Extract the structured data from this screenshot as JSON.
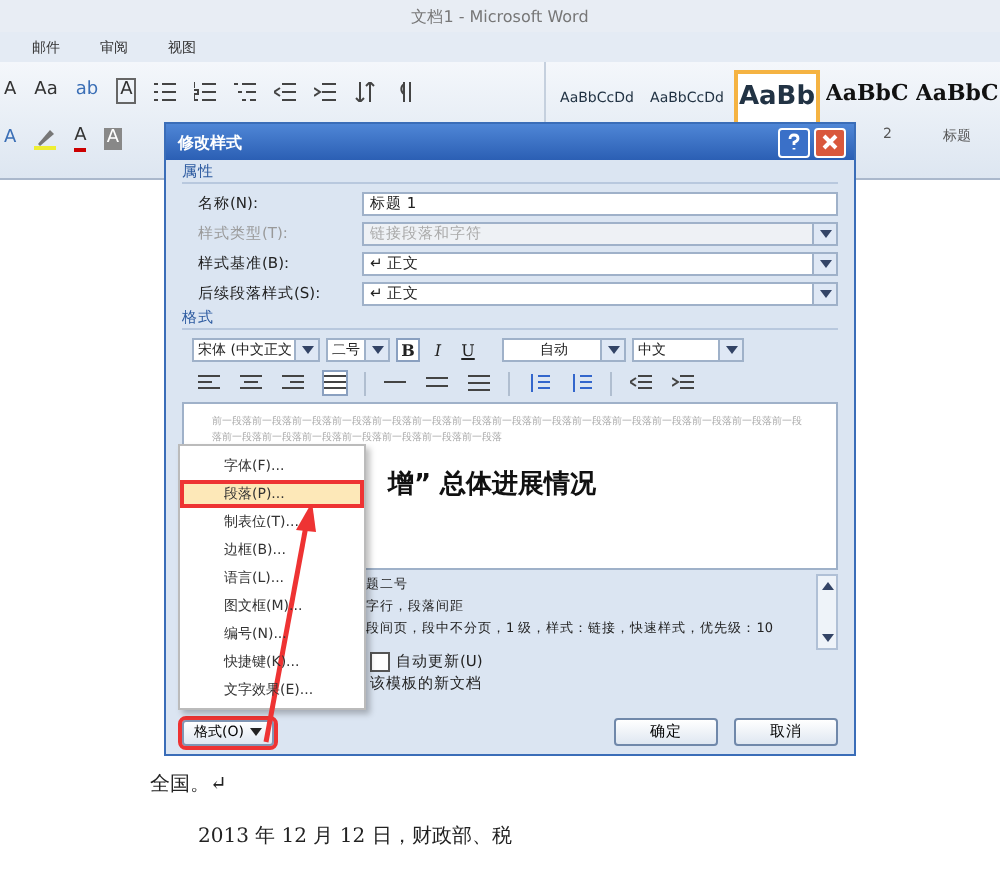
{
  "window": {
    "title": "文档1 - Microsoft Word"
  },
  "ribbon_tabs": [
    "邮件",
    "审阅",
    "视图"
  ],
  "ribbon_row1": [
    {
      "kind": "font_size",
      "text": "A"
    },
    {
      "kind": "change_case",
      "text": "Aa"
    },
    {
      "kind": "phonetic",
      "text": "ab"
    },
    {
      "kind": "border",
      "text": "A"
    },
    {
      "kind": "bullets"
    },
    {
      "kind": "numbering"
    },
    {
      "kind": "multilevel"
    },
    {
      "kind": "outdent"
    },
    {
      "kind": "indent"
    },
    {
      "kind": "sort"
    },
    {
      "kind": "marks"
    }
  ],
  "ribbon_row2": [
    {
      "kind": "effect",
      "text": "A"
    },
    {
      "kind": "highlight"
    },
    {
      "kind": "font_color",
      "text": "A"
    },
    {
      "kind": "shading",
      "text": "A"
    }
  ],
  "style_gallery": [
    {
      "preview": "AaBbCcDd",
      "selected": false
    },
    {
      "preview": "AaBbCcDd",
      "selected": false
    },
    {
      "preview": "AaBb",
      "selected": true
    },
    {
      "preview": "AaBbC",
      "label": "2",
      "selected": false
    },
    {
      "preview": "AaBbC",
      "label": "标题",
      "selected": false
    }
  ],
  "document": {
    "paragraphs": [
      "全国。↵",
      "2013 年 12 月 12 日，财政部、税"
    ]
  },
  "dialog": {
    "title": "修改样式",
    "properties_heading": "属性",
    "fields": [
      {
        "label": "名称(N):",
        "value": "标题 1",
        "kind": "text",
        "disabled": false
      },
      {
        "label": "样式类型(T):",
        "value": "链接段落和字符",
        "kind": "select",
        "disabled": true
      },
      {
        "label": "样式基准(B):",
        "value": "↵ 正文",
        "kind": "select",
        "disabled": false
      },
      {
        "label": "后续段落样式(S):",
        "value": "↵ 正文",
        "kind": "select",
        "disabled": false
      }
    ],
    "format_heading": "格式",
    "font": "宋体 (中文正文",
    "size": "二号",
    "style_buttons": [
      {
        "kind": "bold",
        "text": "B",
        "on": true
      },
      {
        "kind": "italic",
        "text": "I",
        "on": false
      },
      {
        "kind": "underline",
        "text": "U",
        "on": false
      }
    ],
    "font_color_setting": "自动",
    "language": "中文",
    "preview": {
      "previous_text": "前一段落前一段落前一段落前一段落前一段落前一段落前一段落前一段落前一段落前一段落前一段落前一段落前一段落前一段落前一段落前一段落前一段落前一段落前一段落前一段落前一段落前一段落",
      "sample_text": "增” 总体进展情况"
    },
    "description": [
      "题二号",
      "字行，段落间距",
      "段间页，段中不分页，1 级，样式：链接，快速样式，优先级：10"
    ],
    "auto_update": {
      "label": "自动更新(U)",
      "checked": false
    },
    "template_text": "该模板的新文档",
    "format_button": "格式(O)",
    "ok_button": "确定",
    "cancel_button": "取消"
  },
  "format_menu": [
    {
      "label": "字体(F)...",
      "selected": false
    },
    {
      "label": "段落(P)...",
      "selected": true
    },
    {
      "label": "制表位(T)...",
      "selected": false
    },
    {
      "label": "边框(B)...",
      "selected": false
    },
    {
      "label": "语言(L)...",
      "selected": false
    },
    {
      "label": "图文框(M)...",
      "selected": false
    },
    {
      "label": "编号(N)...",
      "selected": false
    },
    {
      "label": "快捷键(K)...",
      "selected": false
    },
    {
      "label": "文字效果(E)...",
      "selected": false
    }
  ]
}
